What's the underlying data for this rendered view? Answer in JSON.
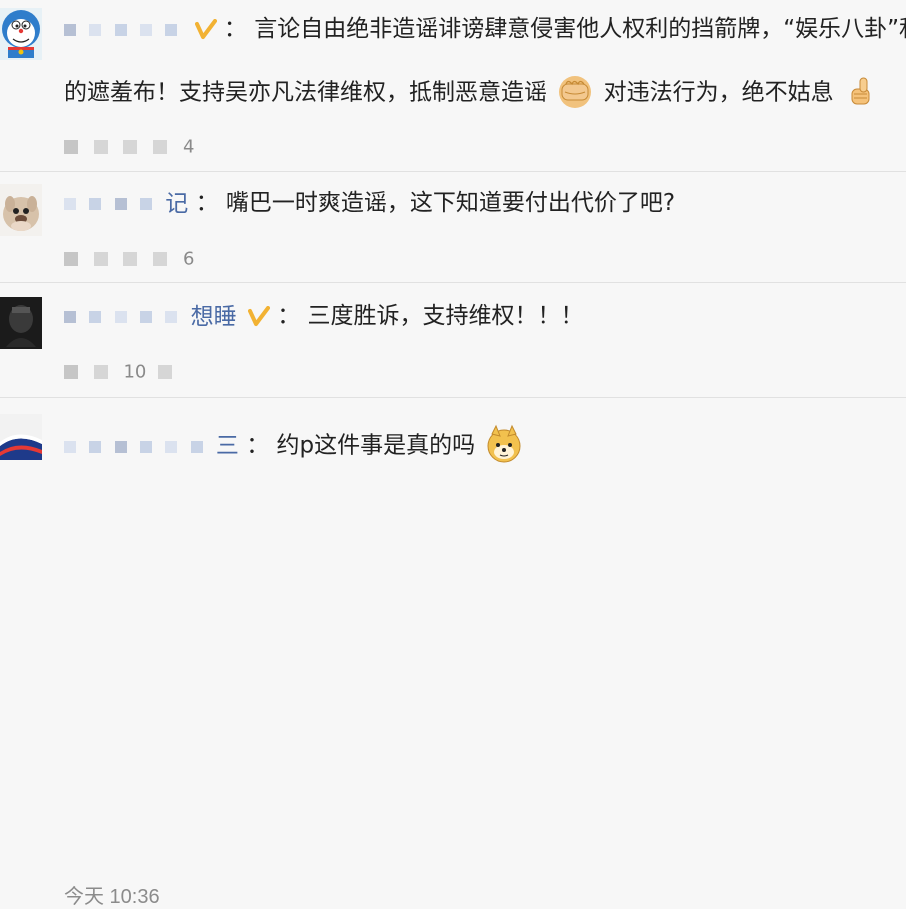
{
  "comments": [
    {
      "name_suffix": "",
      "colon": "：",
      "text_parts": [
        "言论自由绝非造谣诽谤肆意侵害他人权利的挡箭牌，“娱乐八卦”和",
        "的遮羞布！支持吴亦凡法律维权，抵制恶意造谣",
        "对违法行为，绝不姑息"
      ],
      "meta_visible": "4",
      "avatar": "cartoon-robot-avatar",
      "verified": true,
      "emojis": [
        "fist-emoji",
        "thumbs-up-emoji"
      ]
    },
    {
      "name_suffix": "记",
      "colon": "：",
      "text": "嘴巴一时爽造谣，这下知道要付出代价了吧?",
      "meta_visible": "6",
      "avatar": "puppy-avatar",
      "verified": false
    },
    {
      "name_suffix": "想睡",
      "colon": "：",
      "text": "三度胜诉，支持维权！！！",
      "meta_visible": "10",
      "avatar": "dark-photo-avatar",
      "verified": true
    },
    {
      "name_suffix": "三",
      "colon": "：",
      "text": "约p这件事是真的吗",
      "avatar": "flag-avatar",
      "verified": false,
      "emojis": [
        "doge-emoji"
      ]
    }
  ],
  "footer_time": "今天 10:36",
  "colors": {
    "username": "#4a6aa5",
    "verified_badge": "#f2b233",
    "meta": "#8a8a8a",
    "divider": "#e1e1e1"
  }
}
